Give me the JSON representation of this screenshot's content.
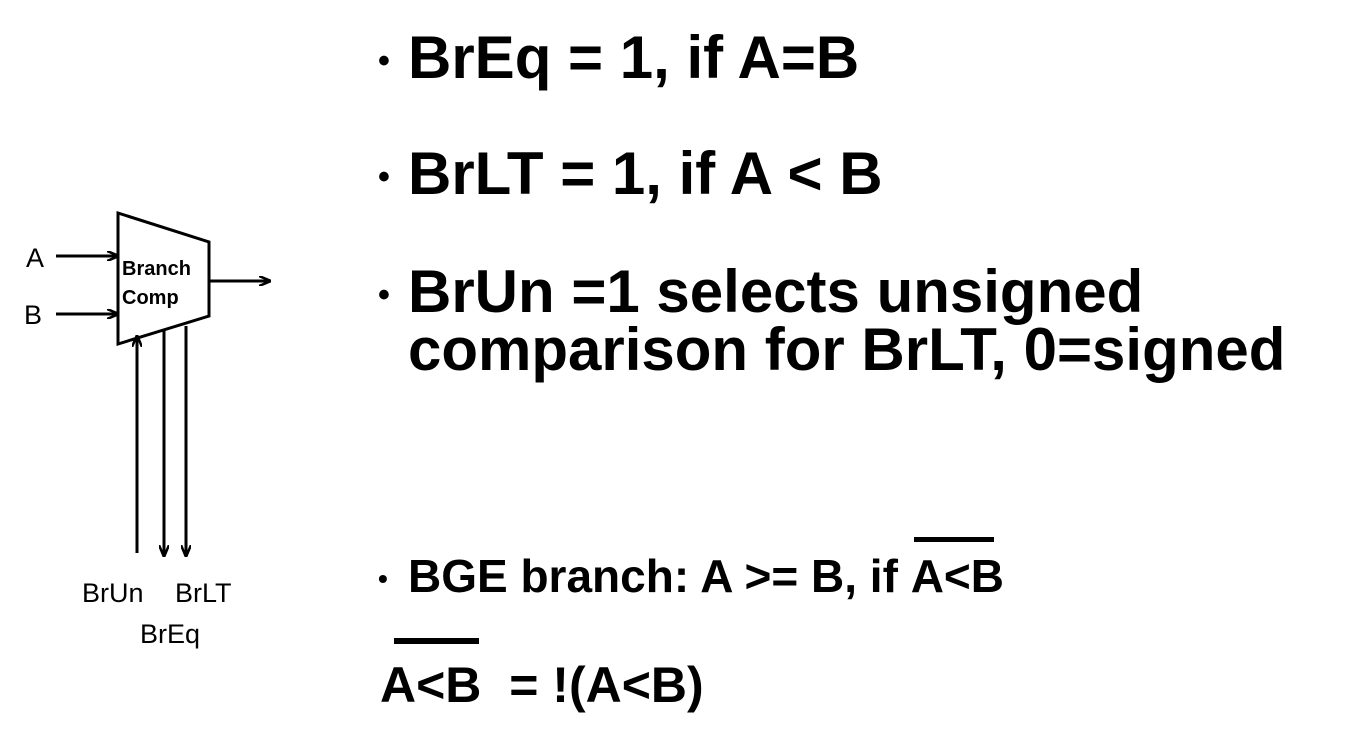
{
  "diagram": {
    "block_label_line1": "Branch",
    "block_label_line2": "Comp",
    "input_a_label": "A",
    "input_b_label": "B",
    "signal_brun_label": "BrUn",
    "signal_brlt_label": "BrLT",
    "signal_breq_label": "BrEq"
  },
  "bullets": [
    {
      "text": "BrEq = 1, if A=B"
    },
    {
      "text": "BrLT = 1, if A < B"
    },
    {
      "line1": "BrUn =1 selects unsigned",
      "line2": "comparison for BrLT, 0=signed"
    },
    {
      "prefix": "BGE branch: A >= B, if ",
      "overlined": "A<B"
    }
  ],
  "bullet_symbol": "•",
  "formula": {
    "overlined": "A<B",
    "rest": "  = !(A<B)"
  }
}
